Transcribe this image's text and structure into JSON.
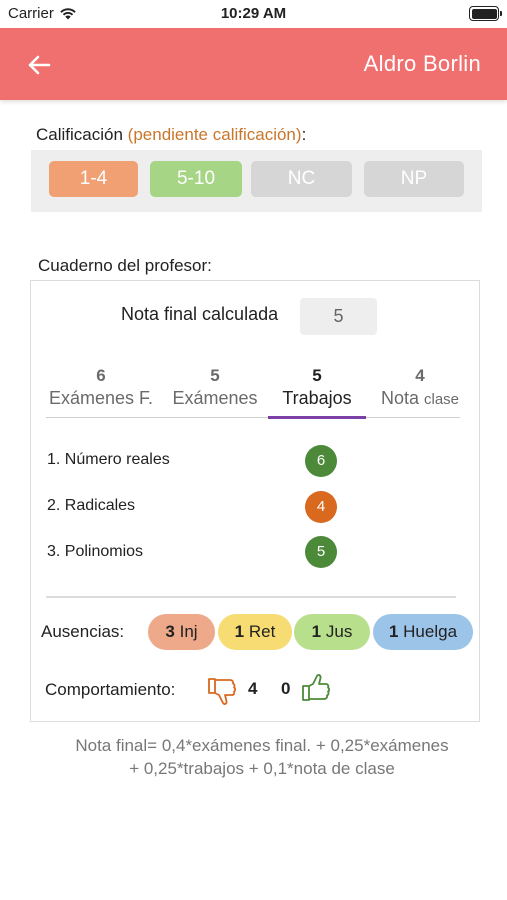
{
  "status_bar": {
    "carrier": "Carrier",
    "time": "10:29 AM"
  },
  "header": {
    "title": "Aldro Borlin",
    "back_icon": "arrow-left-icon",
    "color": "#f07070"
  },
  "calificacion": {
    "label": "Calificación",
    "pending": "(pendiente calificación)",
    "colon": ":",
    "options": [
      {
        "label": "1-4",
        "color": "#f0a072"
      },
      {
        "label": "5-10",
        "color": "#a6d586"
      },
      {
        "label": "NC",
        "color": "#d6d6d6"
      },
      {
        "label": "NP",
        "color": "#d6d6d6"
      }
    ]
  },
  "cuaderno": {
    "label": "Cuaderno del profesor:",
    "nota_final_label": "Nota final calculada",
    "nota_final_value": "5",
    "tabs": [
      {
        "num": "6",
        "label": "Exámenes F.",
        "active": false
      },
      {
        "num": "5",
        "label": "Exámenes",
        "active": false
      },
      {
        "num": "5",
        "label": "Trabajos",
        "active": true
      },
      {
        "num": "4",
        "label": "Nota",
        "label_small": "clase",
        "active": false
      }
    ],
    "active_tab_color": "#7b3fa6",
    "items": [
      {
        "label": "1. Número reales",
        "grade": "6",
        "color": "#4c8a3a"
      },
      {
        "label": "2. Radicales",
        "grade": "4",
        "color": "#d9691f"
      },
      {
        "label": "3. Polinomios",
        "grade": "5",
        "color": "#4c8a3a"
      }
    ],
    "ausencias": {
      "label": "Ausencias:",
      "items": [
        {
          "count": "3",
          "label": "Inj",
          "color": "#eea88a"
        },
        {
          "count": "1",
          "label": "Ret",
          "color": "#f6dc72"
        },
        {
          "count": "1",
          "label": "Jus",
          "color": "#b8e08c"
        },
        {
          "count": "1",
          "label": "Huelga",
          "color": "#9cc4e8"
        }
      ]
    },
    "comportamiento": {
      "label": "Comportamiento:",
      "negative": "4",
      "positive": "0",
      "negative_icon": "thumbs-down-icon",
      "positive_icon": "thumbs-up-icon"
    }
  },
  "formula": {
    "line1": "Nota final= 0,4*exámenes final. + 0,25*exámenes",
    "line2": "+ 0,25*trabajos + 0,1*nota de clase"
  }
}
